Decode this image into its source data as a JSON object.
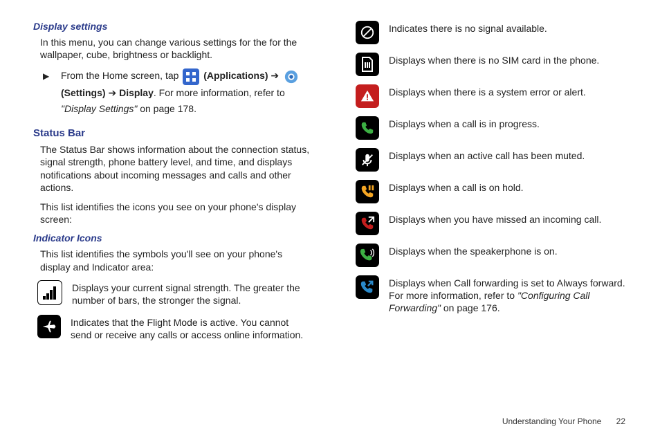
{
  "left": {
    "heading1": "Display settings",
    "para1": "In this menu, you can change various settings for the for the wallpaper, cube, brightness or backlight.",
    "instr_pre": "From the Home screen, tap ",
    "instr_apps": "(Applications)",
    "instr_arrow": " ➔ ",
    "instr_settings": "(Settings)",
    "instr_display": "Display",
    "instr_post": ". For more information, refer to ",
    "instr_ref": "\"Display Settings\"",
    "instr_page": " on page 178.",
    "heading2": "Status Bar",
    "para2": "The Status Bar shows information about the connection status, signal strength, phone battery level, and time, and displays notifications about incoming messages and calls and other actions.",
    "para3": "This list identifies the icons you see on your phone's display screen:",
    "heading3": "Indicator Icons",
    "para4": "This list identifies the symbols you'll see on your phone's display and Indicator area:",
    "icons": [
      {
        "name": "signal-strength-icon",
        "text": "Displays your current signal strength. The greater the number of bars, the stronger the signal."
      },
      {
        "name": "flight-mode-icon",
        "text": "Indicates that the Flight Mode is active. You cannot send or receive any calls or access online information."
      }
    ]
  },
  "right": {
    "icons": [
      {
        "name": "no-signal-icon",
        "text": "Indicates there is no signal available."
      },
      {
        "name": "no-sim-icon",
        "text": "Displays when there is no SIM card in the phone."
      },
      {
        "name": "system-error-icon",
        "text": "Displays when there is a system error or alert."
      },
      {
        "name": "call-in-progress-icon",
        "text": "Displays when a call is in progress."
      },
      {
        "name": "call-muted-icon",
        "text": "Displays when an active call has been muted."
      },
      {
        "name": "call-on-hold-icon",
        "text": "Displays when a call is on hold."
      },
      {
        "name": "missed-call-icon",
        "text": "Displays when you have missed an incoming call."
      },
      {
        "name": "speakerphone-icon",
        "text": "Displays when the speakerphone is on."
      }
    ],
    "last": {
      "name": "call-forwarding-icon",
      "text_pre": "Displays when Call forwarding is set to Always forward. For more information, refer to ",
      "ref": "\"Configuring Call Forwarding\"",
      "text_post": " on page 176."
    }
  },
  "footer": {
    "section": "Understanding Your Phone",
    "page": "22"
  }
}
